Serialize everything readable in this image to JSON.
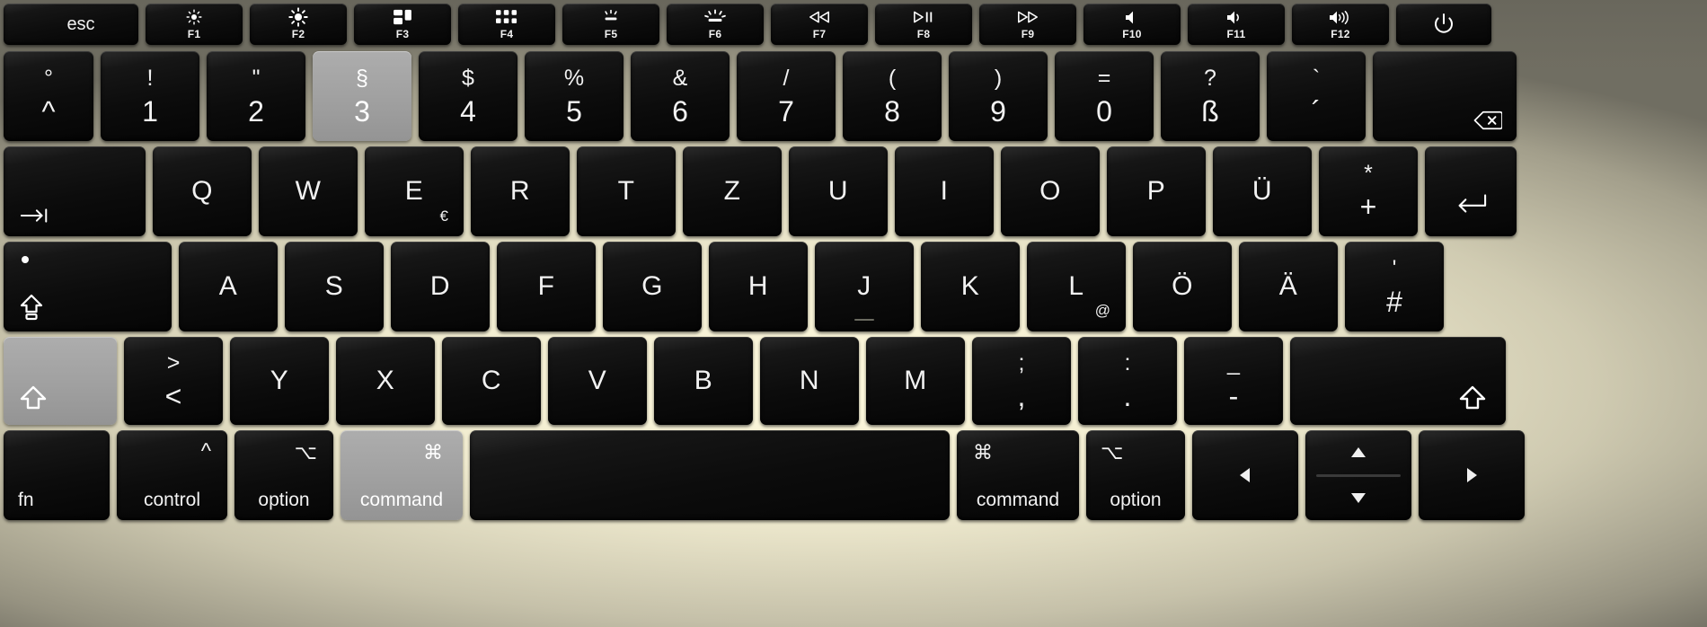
{
  "device": {
    "name": "MacBook Pro German QWERTZ keyboard",
    "layout": "German (QWERTZ)",
    "chassis_color": "#d8d4b8",
    "key_color": "#0d0d0d",
    "highlight_fill": "#a0a0a0",
    "highlight_border": "#fc1b21"
  },
  "highlighted_keys": [
    "3",
    "shift-left",
    "command-left"
  ],
  "rows": {
    "function_row": [
      {
        "id": "esc",
        "label": "esc",
        "fnum": "",
        "icon": ""
      },
      {
        "id": "f1",
        "label": "",
        "fnum": "F1",
        "icon": "brightness-down-icon"
      },
      {
        "id": "f2",
        "label": "",
        "fnum": "F2",
        "icon": "brightness-up-icon"
      },
      {
        "id": "f3",
        "label": "",
        "fnum": "F3",
        "icon": "mission-control-icon"
      },
      {
        "id": "f4",
        "label": "",
        "fnum": "F4",
        "icon": "launchpad-icon"
      },
      {
        "id": "f5",
        "label": "",
        "fnum": "F5",
        "icon": "keyboard-backlight-down-icon"
      },
      {
        "id": "f6",
        "label": "",
        "fnum": "F6",
        "icon": "keyboard-backlight-up-icon"
      },
      {
        "id": "f7",
        "label": "",
        "fnum": "F7",
        "icon": "rewind-icon"
      },
      {
        "id": "f8",
        "label": "",
        "fnum": "F8",
        "icon": "play-pause-icon"
      },
      {
        "id": "f9",
        "label": "",
        "fnum": "F9",
        "icon": "fast-forward-icon"
      },
      {
        "id": "f10",
        "label": "",
        "fnum": "F10",
        "icon": "mute-icon"
      },
      {
        "id": "f11",
        "label": "",
        "fnum": "F11",
        "icon": "volume-down-icon"
      },
      {
        "id": "f12",
        "label": "",
        "fnum": "F12",
        "icon": "volume-up-icon"
      },
      {
        "id": "power",
        "label": "",
        "fnum": "",
        "icon": "power-icon"
      }
    ],
    "number_row": [
      {
        "id": "circ",
        "top": "°",
        "bottom": "^",
        "highlighted": false
      },
      {
        "id": "1",
        "top": "!",
        "bottom": "1",
        "highlighted": false
      },
      {
        "id": "2",
        "top": "\"",
        "bottom": "2",
        "highlighted": false
      },
      {
        "id": "3",
        "top": "§",
        "bottom": "3",
        "highlighted": true
      },
      {
        "id": "4",
        "top": "$",
        "bottom": "4",
        "highlighted": false
      },
      {
        "id": "5",
        "top": "%",
        "bottom": "5",
        "highlighted": false
      },
      {
        "id": "6",
        "top": "&",
        "bottom": "6",
        "highlighted": false
      },
      {
        "id": "7",
        "top": "/",
        "bottom": "7",
        "highlighted": false
      },
      {
        "id": "8",
        "top": "(",
        "bottom": "8",
        "highlighted": false
      },
      {
        "id": "9",
        "top": ")",
        "bottom": "9",
        "highlighted": false
      },
      {
        "id": "0",
        "top": "=",
        "bottom": "0",
        "highlighted": false
      },
      {
        "id": "sharp-s",
        "top": "?",
        "bottom": "ß",
        "highlighted": false
      },
      {
        "id": "acute",
        "top": "`",
        "bottom": "´",
        "highlighted": false
      },
      {
        "id": "delete",
        "top": "",
        "bottom": "",
        "icon": "backspace-icon",
        "highlighted": false
      }
    ],
    "top_letter_row": [
      {
        "id": "tab",
        "main": "",
        "icon": "tab-icon"
      },
      {
        "id": "q",
        "main": "Q",
        "alt": ""
      },
      {
        "id": "w",
        "main": "W",
        "alt": ""
      },
      {
        "id": "e",
        "main": "E",
        "alt": "€"
      },
      {
        "id": "r",
        "main": "R",
        "alt": ""
      },
      {
        "id": "t",
        "main": "T",
        "alt": ""
      },
      {
        "id": "z",
        "main": "Z",
        "alt": ""
      },
      {
        "id": "u",
        "main": "U",
        "alt": ""
      },
      {
        "id": "i",
        "main": "I",
        "alt": ""
      },
      {
        "id": "o",
        "main": "O",
        "alt": ""
      },
      {
        "id": "p",
        "main": "P",
        "alt": ""
      },
      {
        "id": "u-umlaut",
        "main": "Ü",
        "alt": ""
      },
      {
        "id": "plus",
        "top": "*",
        "bottom": "+"
      },
      {
        "id": "return",
        "main": "",
        "icon": "return-icon"
      }
    ],
    "home_row": [
      {
        "id": "capslock",
        "main": "",
        "icon": "capslock-icon"
      },
      {
        "id": "a",
        "main": "A",
        "alt": ""
      },
      {
        "id": "s",
        "main": "S",
        "alt": ""
      },
      {
        "id": "d",
        "main": "D",
        "alt": ""
      },
      {
        "id": "f",
        "main": "F",
        "alt": ""
      },
      {
        "id": "g",
        "main": "G",
        "alt": ""
      },
      {
        "id": "h",
        "main": "H",
        "alt": ""
      },
      {
        "id": "j",
        "main": "J",
        "alt": ""
      },
      {
        "id": "k",
        "main": "K",
        "alt": ""
      },
      {
        "id": "l",
        "main": "L",
        "alt": "@"
      },
      {
        "id": "o-umlaut",
        "main": "Ö",
        "alt": ""
      },
      {
        "id": "a-umlaut",
        "main": "Ä",
        "alt": ""
      },
      {
        "id": "hash",
        "top": "'",
        "bottom": "#"
      }
    ],
    "shift_row": [
      {
        "id": "shift-left",
        "main": "",
        "icon": "shift-icon",
        "highlighted": true
      },
      {
        "id": "angle",
        "top": ">",
        "bottom": "<"
      },
      {
        "id": "y",
        "main": "Y"
      },
      {
        "id": "x",
        "main": "X"
      },
      {
        "id": "c",
        "main": "C"
      },
      {
        "id": "v",
        "main": "V"
      },
      {
        "id": "b",
        "main": "B"
      },
      {
        "id": "n",
        "main": "N"
      },
      {
        "id": "m",
        "main": "M"
      },
      {
        "id": "semicolon",
        "top": ";",
        "bottom": ","
      },
      {
        "id": "colon",
        "top": ":",
        "bottom": "."
      },
      {
        "id": "dash",
        "top": "_",
        "bottom": "-"
      },
      {
        "id": "shift-right",
        "main": "",
        "icon": "shift-icon",
        "highlighted": false
      }
    ],
    "bottom_row": [
      {
        "id": "fn",
        "label": "fn",
        "glyph": "",
        "highlighted": false
      },
      {
        "id": "control",
        "label": "control",
        "glyph": "^",
        "highlighted": false
      },
      {
        "id": "option-left",
        "label": "option",
        "glyph": "⌥",
        "highlighted": false
      },
      {
        "id": "command-left",
        "label": "command",
        "glyph": "⌘",
        "highlighted": true
      },
      {
        "id": "space",
        "label": "",
        "glyph": "",
        "highlighted": false
      },
      {
        "id": "command-right",
        "label": "command",
        "glyph": "⌘",
        "highlighted": false
      },
      {
        "id": "option-right",
        "label": "option",
        "glyph": "⌥",
        "highlighted": false
      },
      {
        "id": "arrow-left",
        "label": "",
        "glyph": "◀",
        "highlighted": false
      },
      {
        "id": "arrow-updown",
        "label": "",
        "glyph": "▲▼",
        "highlighted": false
      },
      {
        "id": "arrow-right",
        "label": "",
        "glyph": "▶",
        "highlighted": false
      }
    ]
  }
}
